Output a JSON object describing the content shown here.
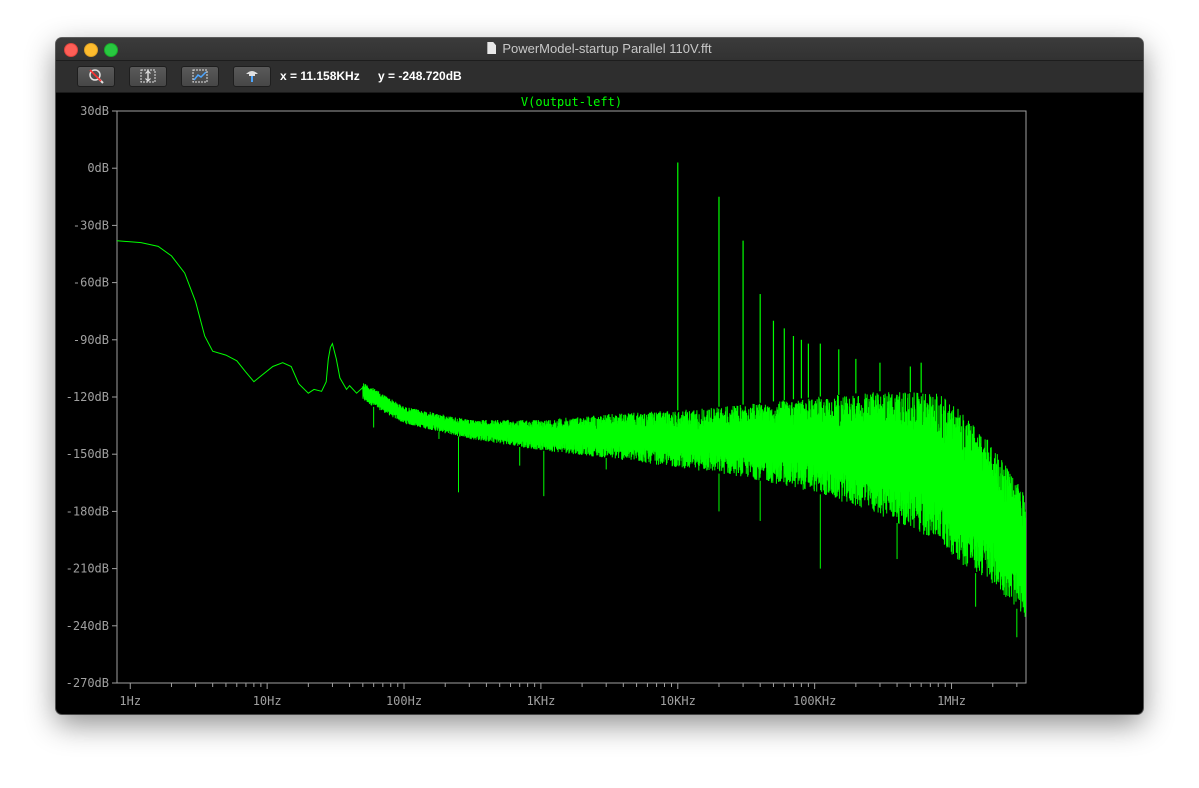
{
  "window": {
    "title": "PowerModel-startup Parallel 110V.fft"
  },
  "toolbar": {
    "buttons": [
      {
        "name": "zoom-cancel",
        "icon": "zoom-cancel-icon"
      },
      {
        "name": "autorange-y",
        "icon": "autorange-y-icon"
      },
      {
        "name": "autorange-axes",
        "icon": "autorange-axes-icon"
      },
      {
        "name": "probe",
        "icon": "probe-icon"
      }
    ],
    "cursor_x": "x = 11.158KHz",
    "cursor_y": "y = -248.720dB"
  },
  "chart_data": {
    "type": "line",
    "title": "V(output-left)",
    "xlabel": "",
    "ylabel": "",
    "x_scale": "log",
    "xlim": [
      0.8,
      3500000
    ],
    "ylim": [
      -270,
      30
    ],
    "x_ticks": [
      {
        "value": 1,
        "label": "1Hz"
      },
      {
        "value": 10,
        "label": "10Hz"
      },
      {
        "value": 100,
        "label": "100Hz"
      },
      {
        "value": 1000,
        "label": "1KHz"
      },
      {
        "value": 10000,
        "label": "10KHz"
      },
      {
        "value": 100000,
        "label": "100KHz"
      },
      {
        "value": 1000000,
        "label": "1MHz"
      }
    ],
    "y_ticks": [
      {
        "value": 30,
        "label": "30dB"
      },
      {
        "value": 0,
        "label": "0dB"
      },
      {
        "value": -30,
        "label": "-30dB"
      },
      {
        "value": -60,
        "label": "-60dB"
      },
      {
        "value": -90,
        "label": "-90dB"
      },
      {
        "value": -120,
        "label": "-120dB"
      },
      {
        "value": -150,
        "label": "-150dB"
      },
      {
        "value": -180,
        "label": "-180dB"
      },
      {
        "value": -210,
        "label": "-210dB"
      },
      {
        "value": -240,
        "label": "-240dB"
      },
      {
        "value": -270,
        "label": "-270dB"
      }
    ],
    "grid": false,
    "series": [
      {
        "name": "V(output-left)",
        "color": "#00ff00",
        "low_freq_curve": [
          [
            0.8,
            -38
          ],
          [
            1.2,
            -39
          ],
          [
            1.6,
            -41
          ],
          [
            2.0,
            -46
          ],
          [
            2.5,
            -55
          ],
          [
            3.0,
            -70
          ],
          [
            3.5,
            -88
          ],
          [
            4.0,
            -96
          ],
          [
            5.0,
            -98
          ],
          [
            6.0,
            -101
          ],
          [
            7.0,
            -107
          ],
          [
            8.0,
            -112
          ],
          [
            9.0,
            -109
          ],
          [
            11.0,
            -104
          ],
          [
            13.0,
            -102
          ],
          [
            15.0,
            -104
          ],
          [
            17.0,
            -113
          ],
          [
            20.0,
            -118
          ],
          [
            22.0,
            -116
          ],
          [
            25.0,
            -117
          ],
          [
            27.0,
            -112
          ],
          [
            28.0,
            -100
          ],
          [
            29.0,
            -94
          ],
          [
            30.0,
            -92
          ],
          [
            32.0,
            -100
          ],
          [
            34.0,
            -110
          ],
          [
            38.0,
            -116
          ],
          [
            40.0,
            -114
          ],
          [
            45.0,
            -118
          ],
          [
            50.0,
            -115
          ]
        ],
        "noise_band_upper": [
          [
            50,
            -112
          ],
          [
            100,
            -125
          ],
          [
            300,
            -132
          ],
          [
            1000,
            -132
          ],
          [
            3000,
            -129
          ],
          [
            10000,
            -127
          ],
          [
            30000,
            -124
          ],
          [
            100000,
            -120
          ],
          [
            300000,
            -117
          ],
          [
            800000,
            -118
          ],
          [
            1200000,
            -128
          ],
          [
            2000000,
            -145
          ],
          [
            3500000,
            -172
          ]
        ],
        "noise_band_lower": [
          [
            50,
            -122
          ],
          [
            100,
            -134
          ],
          [
            300,
            -142
          ],
          [
            1000,
            -148
          ],
          [
            3000,
            -152
          ],
          [
            10000,
            -157
          ],
          [
            30000,
            -162
          ],
          [
            100000,
            -170
          ],
          [
            300000,
            -182
          ],
          [
            800000,
            -196
          ],
          [
            1200000,
            -208
          ],
          [
            2000000,
            -218
          ],
          [
            3500000,
            -236
          ]
        ],
        "spikes": [
          {
            "x": 10000,
            "y": 3
          },
          {
            "x": 20000,
            "y": -15
          },
          {
            "x": 30000,
            "y": -38
          },
          {
            "x": 40000,
            "y": -66
          },
          {
            "x": 50000,
            "y": -80
          },
          {
            "x": 60000,
            "y": -84
          },
          {
            "x": 70000,
            "y": -88
          },
          {
            "x": 80000,
            "y": -90
          },
          {
            "x": 90000,
            "y": -92
          },
          {
            "x": 110000,
            "y": -92
          },
          {
            "x": 150000,
            "y": -95
          },
          {
            "x": 200000,
            "y": -100
          },
          {
            "x": 300000,
            "y": -102
          },
          {
            "x": 500000,
            "y": -104
          },
          {
            "x": 600000,
            "y": -102
          }
        ],
        "dips": [
          {
            "x": 60,
            "y": -136
          },
          {
            "x": 180,
            "y": -142
          },
          {
            "x": 250,
            "y": -170
          },
          {
            "x": 700,
            "y": -156
          },
          {
            "x": 1050,
            "y": -172
          },
          {
            "x": 3000,
            "y": -158
          },
          {
            "x": 20000,
            "y": -180
          },
          {
            "x": 40000,
            "y": -185
          },
          {
            "x": 110000,
            "y": -210
          },
          {
            "x": 400000,
            "y": -205
          },
          {
            "x": 1500000,
            "y": -230
          },
          {
            "x": 3000000,
            "y": -246
          }
        ]
      }
    ]
  }
}
